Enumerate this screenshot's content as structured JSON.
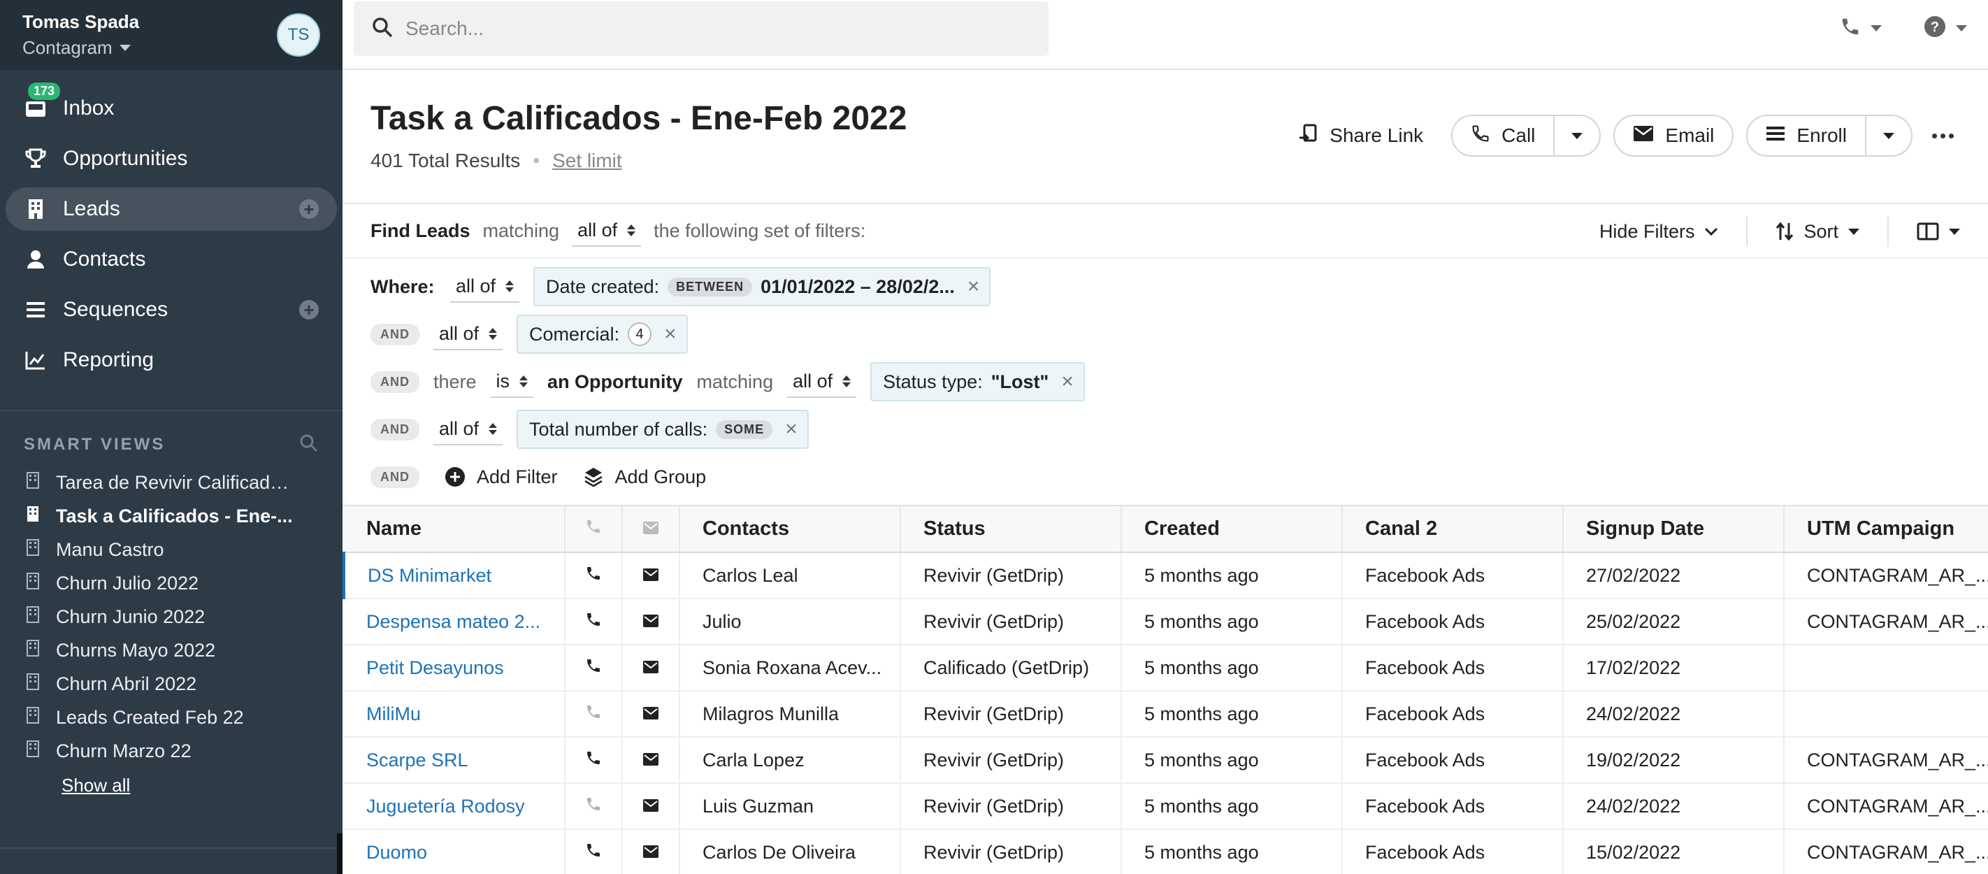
{
  "user": {
    "name": "Tomas Spada",
    "org": "Contagram",
    "initials": "TS"
  },
  "nav": {
    "items": [
      {
        "label": "Inbox",
        "badge": "173"
      },
      {
        "label": "Opportunities"
      },
      {
        "label": "Leads"
      },
      {
        "label": "Contacts"
      },
      {
        "label": "Sequences"
      },
      {
        "label": "Reporting"
      }
    ]
  },
  "smart_views": {
    "title": "SMART VIEWS",
    "items": [
      "Tarea de Revivir Calificado...",
      "Task a Calificados - Ene-...",
      "Manu Castro",
      "Churn Julio 2022",
      "Churn Junio 2022",
      "Churns Mayo 2022",
      "Churn Abril 2022",
      "Leads Created Feb 22",
      "Churn Marzo 22"
    ],
    "show_all": "Show all"
  },
  "search": {
    "placeholder": "Search..."
  },
  "header": {
    "title": "Task a Calificados - Ene-Feb 2022",
    "results": "401 Total Results",
    "set_limit": "Set limit",
    "share_link": "Share Link",
    "call": "Call",
    "email": "Email",
    "enroll": "Enroll"
  },
  "filters": {
    "find": "Find Leads",
    "matching": "matching",
    "all_of": "all of",
    "following": "the following set of filters:",
    "hide_filters": "Hide Filters",
    "sort": "Sort",
    "where": "Where:",
    "and": "AND",
    "date_created": "Date created:",
    "between": "BETWEEN",
    "date_range": "01/01/2022 – 28/02/2...",
    "comercial": "Comercial:",
    "comercial_count": "4",
    "there": "there",
    "is": "is",
    "an_opportunity": "an Opportunity",
    "status_type": "Status type: ",
    "status_value": "\"Lost\"",
    "total_calls": "Total number of calls:",
    "some": "SOME",
    "add_filter": "Add Filter",
    "add_group": "Add Group"
  },
  "table": {
    "columns": [
      "Name",
      "Contacts",
      "Status",
      "Created",
      "Canal 2",
      "Signup Date",
      "UTM Campaign"
    ],
    "rows": [
      {
        "name": "DS Minimarket",
        "phone_active": true,
        "contact": "Carlos Leal",
        "status": "Revivir (GetDrip)",
        "created": "5 months ago",
        "canal": "Facebook Ads",
        "signup": "27/02/2022",
        "utm": "CONTAGRAM_AR_..."
      },
      {
        "name": "Despensa mateo 2...",
        "phone_active": true,
        "contact": "Julio",
        "status": "Revivir (GetDrip)",
        "created": "5 months ago",
        "canal": "Facebook Ads",
        "signup": "25/02/2022",
        "utm": "CONTAGRAM_AR_..."
      },
      {
        "name": "Petit Desayunos",
        "phone_active": true,
        "contact": "Sonia Roxana Acev...",
        "status": "Calificado (GetDrip)",
        "created": "5 months ago",
        "canal": "Facebook Ads",
        "signup": "17/02/2022",
        "utm": ""
      },
      {
        "name": "MiliMu",
        "phone_active": false,
        "contact": "Milagros Munilla",
        "status": "Revivir (GetDrip)",
        "created": "5 months ago",
        "canal": "Facebook Ads",
        "signup": "24/02/2022",
        "utm": ""
      },
      {
        "name": "Scarpe SRL",
        "phone_active": true,
        "contact": "Carla Lopez",
        "status": "Revivir (GetDrip)",
        "created": "5 months ago",
        "canal": "Facebook Ads",
        "signup": "19/02/2022",
        "utm": "CONTAGRAM_AR_..."
      },
      {
        "name": "Juguetería Rodosy",
        "phone_active": false,
        "contact": "Luis Guzman",
        "status": "Revivir (GetDrip)",
        "created": "5 months ago",
        "canal": "Facebook Ads",
        "signup": "24/02/2022",
        "utm": "CONTAGRAM_AR_..."
      },
      {
        "name": "Duomo",
        "phone_active": true,
        "contact": "Carlos De Oliveira",
        "status": "Revivir (GetDrip)",
        "created": "5 months ago",
        "canal": "Facebook Ads",
        "signup": "15/02/2022",
        "utm": "CONTAGRAM_AR_..."
      }
    ]
  }
}
